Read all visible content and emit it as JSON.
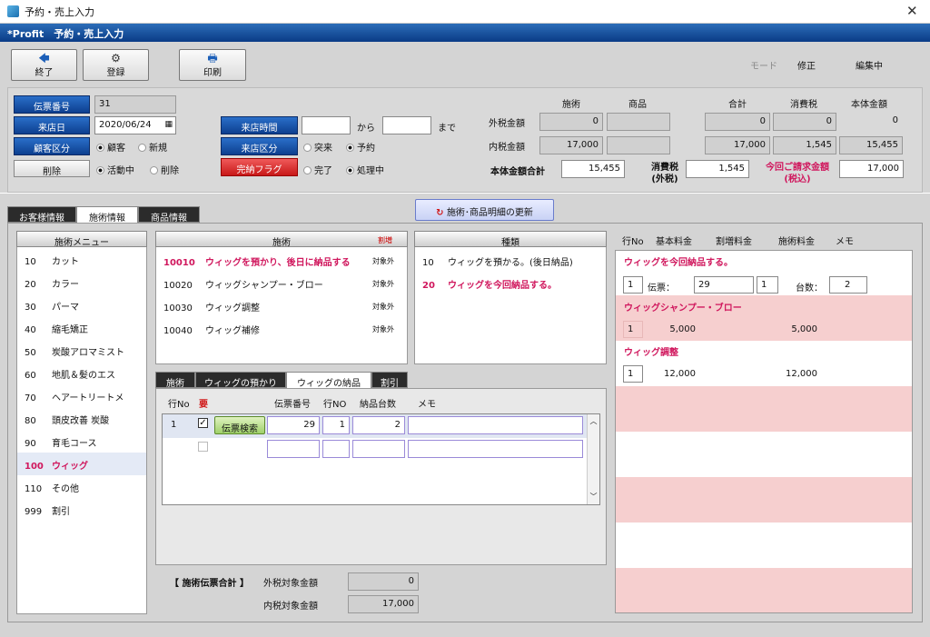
{
  "window": {
    "title": "予約・売上入力",
    "app_title": "*Profit　予約・売上入力",
    "close": "✕"
  },
  "toolbar": {
    "exit": "終了",
    "register": "登録",
    "print": "印刷",
    "mode_label": "モード",
    "mode_value": "修正",
    "status": "編集中"
  },
  "header": {
    "slip_no_label": "伝票番号",
    "slip_no": "31",
    "visit_date_label": "来店日",
    "visit_date": "2020/06/24",
    "customer_type_label": "顧客区分",
    "customer_opt1": "顧客",
    "customer_opt2": "新規",
    "delete_label": "削除",
    "active_opt1": "活動中",
    "active_opt2": "削除",
    "visit_time_label": "来店時間",
    "from": "から",
    "to": "まで",
    "visit_type_label": "来店区分",
    "visit_opt1": "突来",
    "visit_opt2": "予約",
    "complete_flag_label": "完納フラグ",
    "complete_opt1": "完了",
    "complete_opt2": "処理中"
  },
  "amounts": {
    "col_service": "施術",
    "col_product": "商品",
    "col_total": "合計",
    "col_tax": "消費税",
    "col_base": "本体金額",
    "excl_label": "外税金額",
    "excl_service": "0",
    "excl_product": "",
    "excl_total": "0",
    "excl_tax": "0",
    "excl_base": "0",
    "incl_label": "内税金額",
    "incl_service": "17,000",
    "incl_product": "",
    "incl_total": "17,000",
    "incl_tax": "1,545",
    "incl_base": "15,455",
    "base_sum_label": "本体金額合計",
    "base_sum": "15,455",
    "tax_label1": "消費税",
    "tax_label2": "(外税)",
    "tax_value": "1,545",
    "bill_label1": "今回ご請求金額",
    "bill_label2": "(税込)",
    "bill_value": "17,000"
  },
  "tabs": {
    "customer": "お客様情報",
    "service": "施術情報",
    "product": "商品情報",
    "refresh": "施術･商品明細の更新"
  },
  "menu": {
    "title": "施術メニュー",
    "items": [
      {
        "code": "10",
        "name": "カット"
      },
      {
        "code": "20",
        "name": "カラー"
      },
      {
        "code": "30",
        "name": "パーマ"
      },
      {
        "code": "40",
        "name": "縮毛矯正"
      },
      {
        "code": "50",
        "name": "炭酸アロマミスト"
      },
      {
        "code": "60",
        "name": "地肌＆髪のエス"
      },
      {
        "code": "70",
        "name": "ヘアートリートメ"
      },
      {
        "code": "80",
        "name": "頭皮改善 炭酸"
      },
      {
        "code": "90",
        "name": "育毛コース"
      },
      {
        "code": "100",
        "name": "ウィッグ"
      },
      {
        "code": "110",
        "name": "その他"
      },
      {
        "code": "999",
        "name": "割引"
      }
    ]
  },
  "services": {
    "title": "施術",
    "surcharge": "割増",
    "items": [
      {
        "code": "10010",
        "name": "ウィッグを預かり、後日に納品する",
        "tag": "対象外"
      },
      {
        "code": "10020",
        "name": "ウィッグシャンプー・ブロー",
        "tag": "対象外"
      },
      {
        "code": "10030",
        "name": "ウィッグ調整",
        "tag": "対象外"
      },
      {
        "code": "10040",
        "name": "ウィッグ補修",
        "tag": "対象外"
      }
    ]
  },
  "kinds": {
    "title": "種類",
    "items": [
      {
        "code": "10",
        "name": "ウィッグを預かる。(後日納品)"
      },
      {
        "code": "20",
        "name": "ウィッグを今回納品する。"
      }
    ]
  },
  "subtabs": {
    "t1": "施術",
    "t2": "ウィッグの預かり",
    "t3": "ウィッグの納品",
    "t4": "割引"
  },
  "delivery": {
    "h_row": "行No",
    "h_req": "要",
    "h_slip": "伝票番号",
    "h_line": "行NO",
    "h_qty": "納品台数",
    "h_memo": "メモ",
    "row1_no": "1",
    "search_btn": "伝票検索",
    "row1_slip": "29",
    "row1_line": "1",
    "row1_qty": "2"
  },
  "totals": {
    "label": "【 施術伝票合計 】",
    "excl_label": "外税対象金額",
    "excl_value": "0",
    "incl_label": "内税対象金額",
    "incl_value": "17,000"
  },
  "detail": {
    "h_row": "行No",
    "h_base": "基本料金",
    "h_extra": "割増料金",
    "h_fee": "施術料金",
    "h_memo": "メモ",
    "g1_title": "ウィッグを今回納品する。",
    "g1_row": "1",
    "g1_slip_label": "伝票：",
    "g1_slip": "29",
    "g1_line": "1",
    "g1_count_label": "台数：",
    "g1_count": "2",
    "g2_title": "ウィッグシャンプー・ブロー",
    "g2_row": "1",
    "g2_base": "5,000",
    "g2_fee": "5,000",
    "g3_title": "ウィッグ調整",
    "g3_row": "1",
    "g3_base": "12,000",
    "g3_fee": "12,000"
  }
}
